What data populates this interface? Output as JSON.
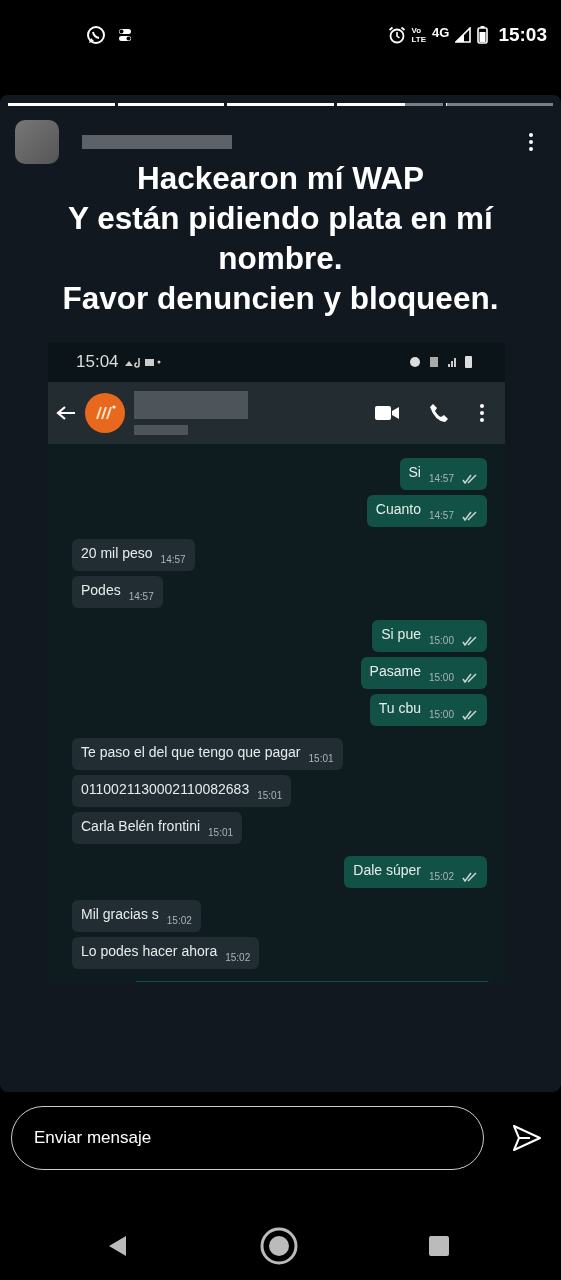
{
  "status_bar": {
    "volte_top": "Vo",
    "volte_bottom": "LTE",
    "network": "4G",
    "time": "15:03"
  },
  "story": {
    "progress": [
      {
        "level": 1
      },
      {
        "level": 1
      },
      {
        "level": 1
      },
      {
        "level": 0.64
      },
      {
        "level": 0
      }
    ],
    "caption": "Hackearon mí WAP\nY están pidiendo plata en mí nombre.\nFavor denuncien y bloqueen.",
    "screenshot": {
      "time": "15:04",
      "messages": [
        {
          "kind": "sent",
          "text": "Si",
          "time": "14:57"
        },
        {
          "kind": "sent",
          "text": "Cuanto",
          "time": "14:57"
        },
        {
          "kind": "received",
          "text": "20 mil peso",
          "time": "14:57"
        },
        {
          "kind": "received",
          "text": "Podes",
          "time": "14:57"
        },
        {
          "kind": "sent",
          "text": "Si pue",
          "time": "15:00"
        },
        {
          "kind": "sent",
          "text": "Pasame",
          "time": "15:00"
        },
        {
          "kind": "sent",
          "text": "Tu cbu",
          "time": "15:00"
        },
        {
          "kind": "received",
          "text": "Te paso el del que tengo que pagar",
          "time": "15:01"
        },
        {
          "kind": "received",
          "text": "0110021130002110082683",
          "time": "15:01"
        },
        {
          "kind": "received",
          "text": "Carla Belén frontini",
          "time": "15:01"
        },
        {
          "kind": "sent",
          "text": "Dale súper",
          "time": "15:02"
        },
        {
          "kind": "received",
          "text": "Mil gracias s",
          "time": "15:02"
        },
        {
          "kind": "received",
          "text": "Lo podes hacer ahora",
          "time": "15:02"
        }
      ]
    }
  },
  "reply": {
    "placeholder": "Enviar mensaje"
  }
}
